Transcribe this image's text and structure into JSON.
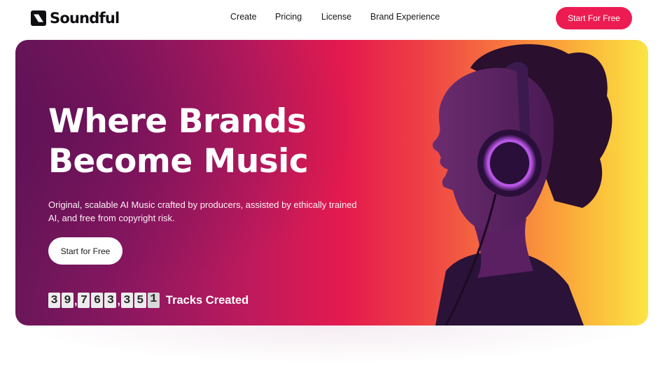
{
  "brand": {
    "name": "Soundful"
  },
  "nav": {
    "links": [
      {
        "label": "Create"
      },
      {
        "label": "Pricing"
      },
      {
        "label": "License"
      },
      {
        "label": "Brand Experience"
      }
    ],
    "cta_label": "Start For Free"
  },
  "hero": {
    "headline_line1": "Where Brands",
    "headline_line2": "Become Music",
    "subtext": "Original, scalable AI Music crafted by producers, assisted by ethically trained AI, and free from copyright risk.",
    "cta_label": "Start for Free",
    "counter": {
      "digits": [
        "3",
        "9",
        ",",
        "7",
        "6",
        "3",
        ",",
        "3",
        "5",
        "1"
      ],
      "label": "Tracks Created"
    }
  },
  "colors": {
    "accent": "#ec1c52",
    "gradient_start": "#6a1659",
    "gradient_mid": "#e41a4e",
    "gradient_end": "#fbe545"
  },
  "icons": {
    "logo": "soundful-s-logo-icon"
  }
}
